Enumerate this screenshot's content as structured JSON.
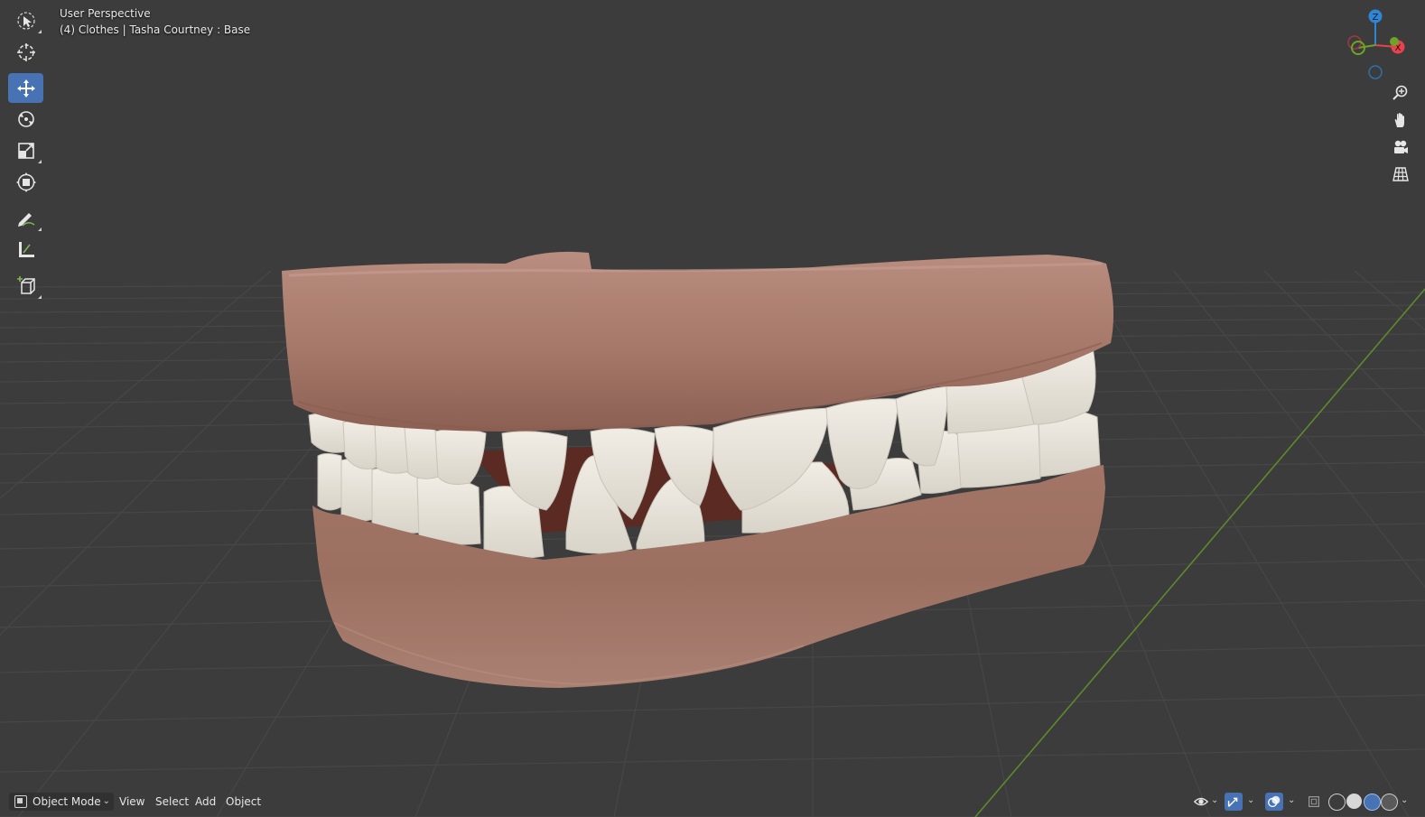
{
  "viewport": {
    "title": "User Perspective",
    "object_info": "(4) Clothes | Tasha Courtney : Base"
  },
  "toolbar": {
    "tools": [
      {
        "name": "select-box-tool",
        "icon": "cursor-select-icon",
        "active": false
      },
      {
        "name": "cursor-tool",
        "icon": "crosshair-cursor-icon",
        "active": false
      },
      {
        "name": "move-tool",
        "icon": "move-arrows-icon",
        "active": true
      },
      {
        "name": "rotate-tool",
        "icon": "rotate-icon",
        "active": false
      },
      {
        "name": "scale-tool",
        "icon": "scale-icon",
        "active": false
      },
      {
        "name": "transform-tool",
        "icon": "transform-icon",
        "active": false
      },
      {
        "name": "annotate-tool",
        "icon": "pencil-annotate-icon",
        "active": false
      },
      {
        "name": "measure-tool",
        "icon": "ruler-measure-icon",
        "active": false
      },
      {
        "name": "add-cube-tool",
        "icon": "add-cube-icon",
        "active": false
      }
    ]
  },
  "gizmo": {
    "axes": {
      "z": "Z",
      "x": "X",
      "y": "Y"
    },
    "colors": {
      "x": "#e8424c",
      "y": "#6da428",
      "z": "#2f86d4"
    }
  },
  "nav_buttons": [
    "zoom-icon",
    "hand-pan-icon",
    "camera-icon",
    "grid-ortho-icon"
  ],
  "header": {
    "mode": "Object Mode",
    "menus": {
      "view": "View",
      "select": "Select",
      "add": "Add",
      "object": "Object"
    }
  },
  "colors": {
    "background": "#3c3c3c",
    "grid": "#464646",
    "active_tool": "#4772b3",
    "gum": "#a67a6c",
    "teeth": "#e8e4db"
  }
}
